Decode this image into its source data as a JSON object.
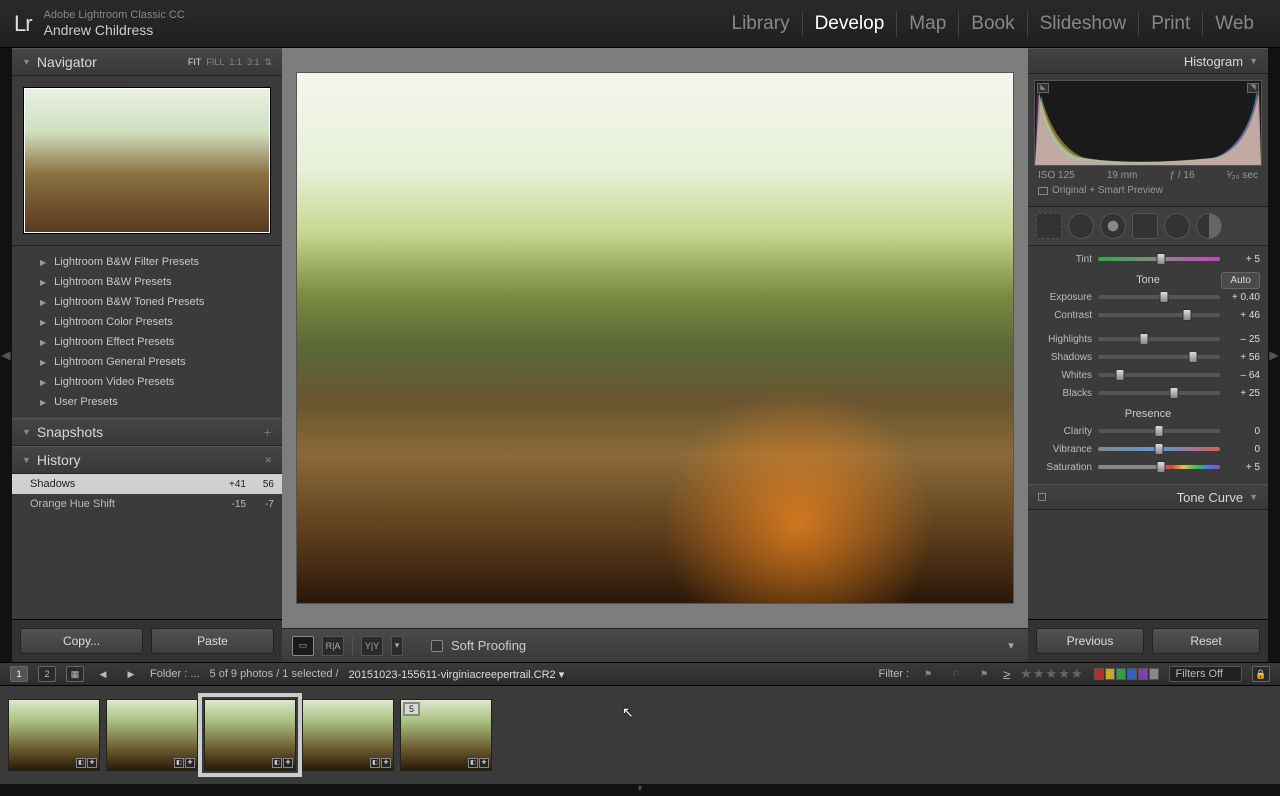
{
  "header": {
    "app_name": "Adobe Lightroom Classic CC",
    "user": "Andrew Childress",
    "logo": "Lr",
    "modules": [
      "Library",
      "Develop",
      "Map",
      "Book",
      "Slideshow",
      "Print",
      "Web"
    ],
    "active_module": "Develop"
  },
  "navigator": {
    "title": "Navigator",
    "zoom_opts": [
      "FIT",
      "FILL",
      "1:1",
      "3:1"
    ],
    "zoom_active": "FIT"
  },
  "presets": {
    "items": [
      "Lightroom B&W Filter Presets",
      "Lightroom B&W Presets",
      "Lightroom B&W Toned Presets",
      "Lightroom Color Presets",
      "Lightroom Effect Presets",
      "Lightroom General Presets",
      "Lightroom Video Presets",
      "User Presets"
    ]
  },
  "snapshots": {
    "title": "Snapshots"
  },
  "history": {
    "title": "History",
    "items": [
      {
        "name": "Shadows",
        "v1": "+41",
        "v2": "56",
        "active": true
      },
      {
        "name": "Orange Hue Shift",
        "v1": "-15",
        "v2": "-7",
        "active": false
      }
    ]
  },
  "left_buttons": {
    "copy": "Copy...",
    "paste": "Paste"
  },
  "center": {
    "soft_proofing": "Soft Proofing"
  },
  "histogram": {
    "title": "Histogram",
    "iso": "ISO 125",
    "focal": "19 mm",
    "aperture": "ƒ / 16",
    "shutter": "¹⁄₂₀ sec",
    "preview_mode": "Original + Smart Preview"
  },
  "basic": {
    "tint_label": "Tint",
    "tint_val": "+ 5",
    "tone_label": "Tone",
    "auto": "Auto",
    "exposure": "Exposure",
    "exposure_val": "+ 0.40",
    "contrast": "Contrast",
    "contrast_val": "+ 46",
    "highlights": "Highlights",
    "highlights_val": "– 25",
    "shadows": "Shadows",
    "shadows_val": "+ 56",
    "whites": "Whites",
    "whites_val": "– 64",
    "blacks": "Blacks",
    "blacks_val": "+ 25",
    "presence_label": "Presence",
    "clarity": "Clarity",
    "clarity_val": "0",
    "vibrance": "Vibrance",
    "vibrance_val": "0",
    "saturation": "Saturation",
    "saturation_val": "+ 5"
  },
  "tone_curve": {
    "title": "Tone Curve"
  },
  "right_buttons": {
    "previous": "Previous",
    "reset": "Reset"
  },
  "info_bar": {
    "grid1": "1",
    "grid2": "2",
    "folder": "Folder : ...",
    "count": "5 of 9 photos / 1 selected /",
    "filename": "20151023-155611-virginiacreepertrail.CR2",
    "filter_label": "Filter :",
    "gte": "≥",
    "filters_off": "Filters Off"
  },
  "filmstrip": {
    "thumbs": [
      {
        "selected": false
      },
      {
        "selected": false
      },
      {
        "selected": true
      },
      {
        "selected": false
      },
      {
        "selected": false,
        "stack": "5"
      }
    ]
  },
  "colors": {
    "labels": [
      "#b03030",
      "#c8a830",
      "#30a040",
      "#3060c0",
      "#8040b0",
      "#888"
    ]
  }
}
